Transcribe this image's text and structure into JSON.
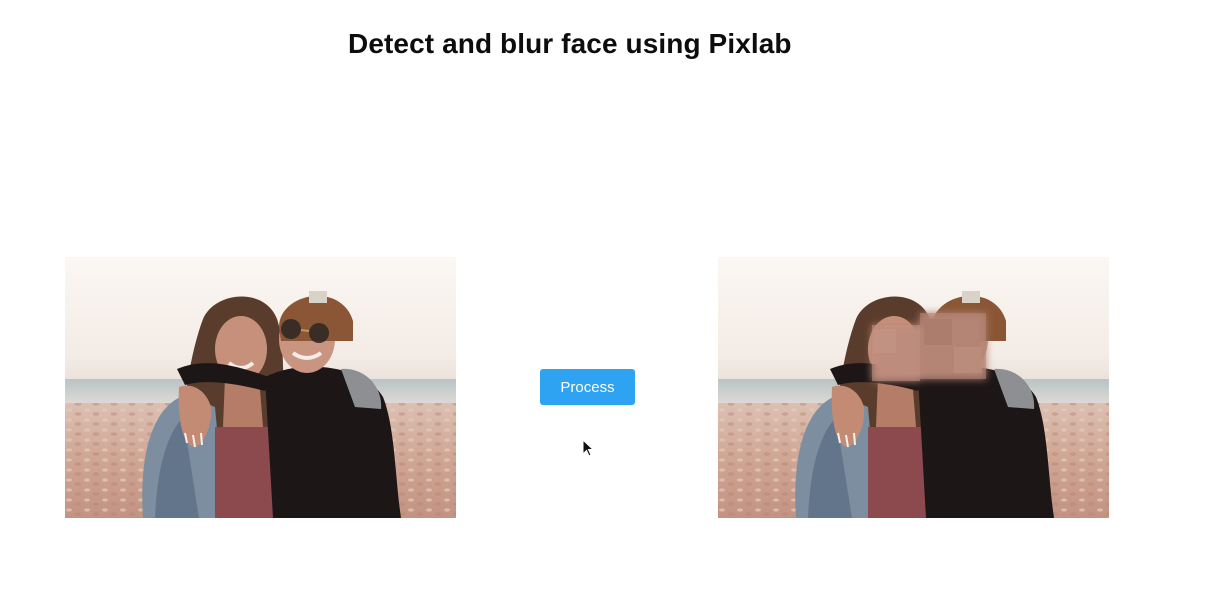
{
  "page": {
    "title": "Detect and blur face using Pixlab"
  },
  "images": {
    "original": {
      "alt": "",
      "faces_blurred": false
    },
    "processed": {
      "alt": "",
      "faces_blurred": true
    }
  },
  "actions": {
    "process_label": "Process"
  },
  "colors": {
    "button_bg": "#2ea3f2",
    "button_text": "#ffffff",
    "title_text": "#0d0d0d",
    "page_bg": "#ffffff"
  },
  "icons": {
    "cursor": "mouse-pointer-icon"
  }
}
